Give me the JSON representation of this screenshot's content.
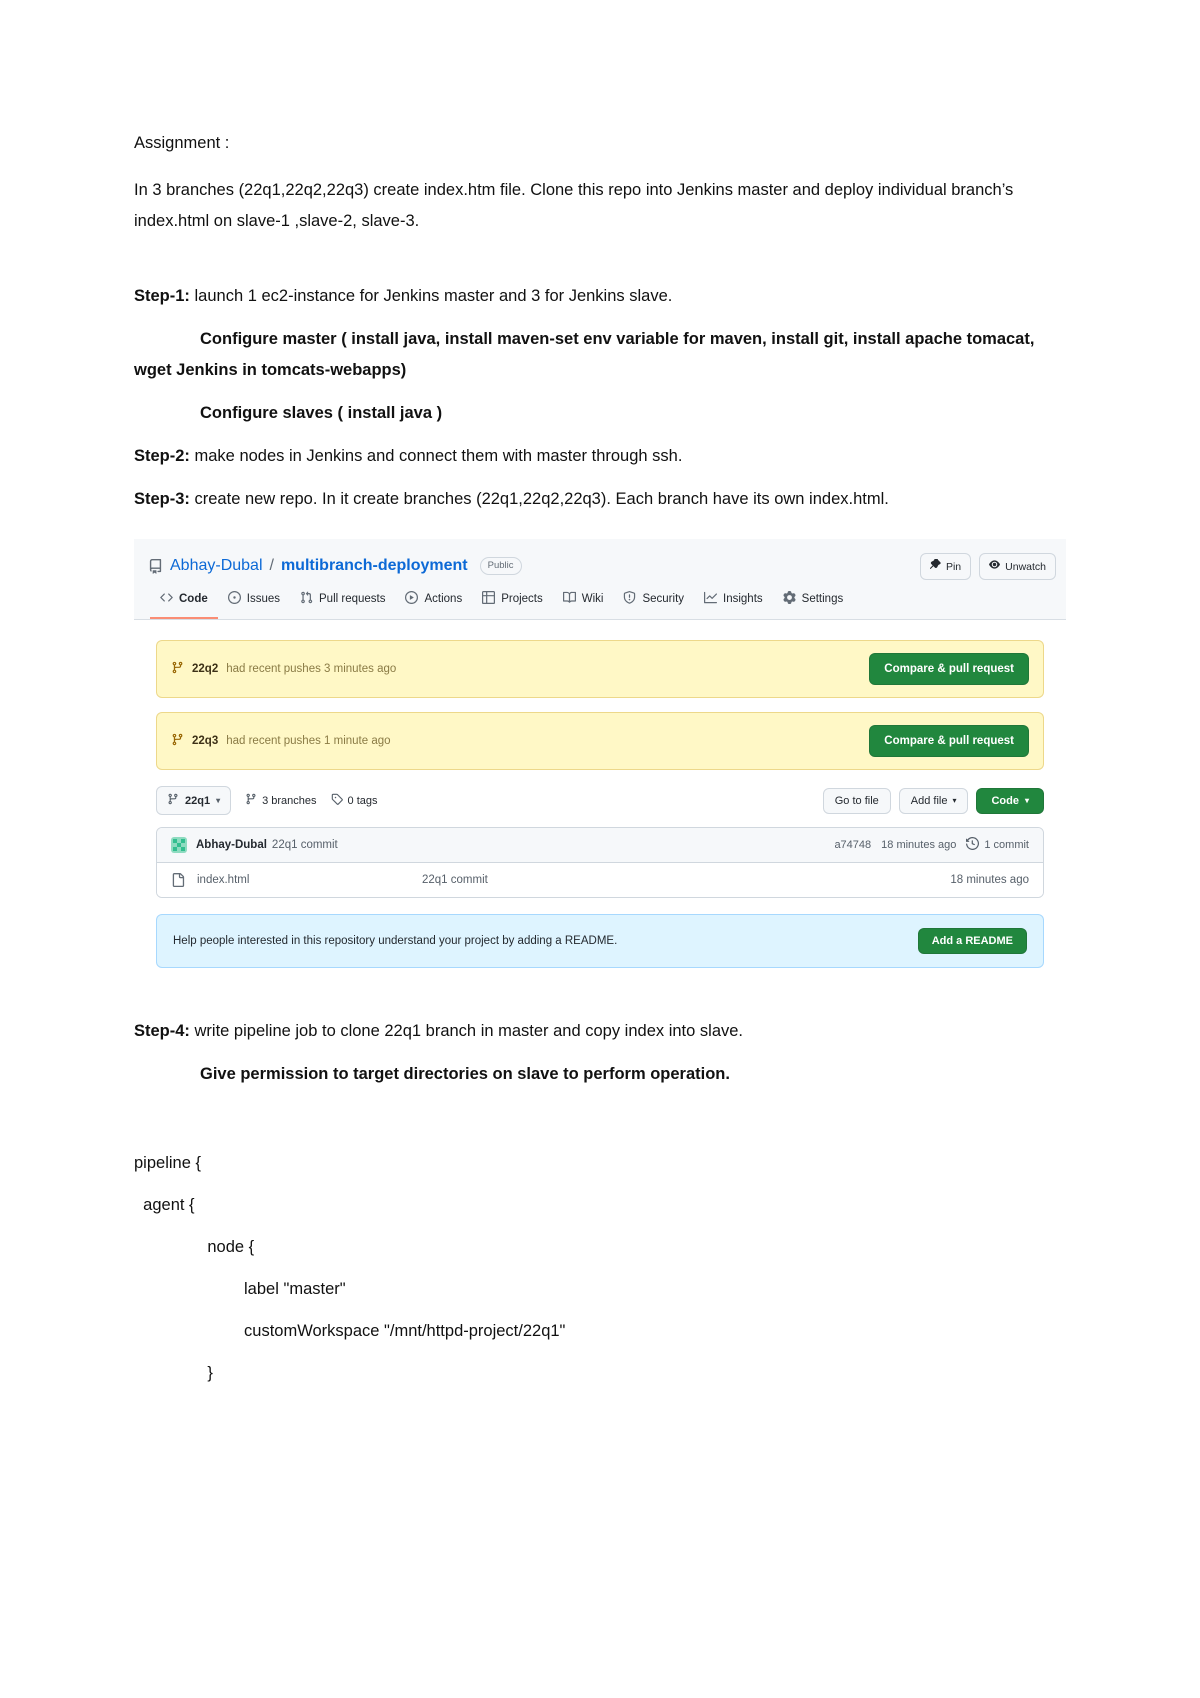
{
  "document": {
    "title": "Assignment :",
    "intro": " In 3 branches (22q1,22q2,22q3) create index.htm file. Clone this repo into Jenkins master and deploy individual branch’s index.html on slave-1 ,slave-2, slave-3.",
    "step1_label": "Step-1:",
    "step1_text": " launch 1 ec2-instance for Jenkins master and 3 for Jenkins slave.",
    "configure_master": "Configure master ( install java, install maven-set env variable for maven, install git, install apache tomacat, wget Jenkins in tomcats-webapps)",
    "configure_slaves": "Configure slaves ( install java )",
    "step2_label": "Step-2:",
    "step2_text": " make nodes in Jenkins and connect them with master through ssh.",
    "step3_label": "Step-3:",
    "step3_text": " create new repo. In it create branches (22q1,22q2,22q3).  Each branch have its own index.html.",
    "step4_label": "Step-4:",
    "step4_text": "  write pipeline job to clone 22q1 branch in master and copy index into slave.",
    "permission_note": "Give permission to target directories on slave to perform operation.",
    "code_lines": [
      "pipeline {",
      "  agent {",
      "                node {",
      "                        label \"master\"",
      "                        customWorkspace \"/mnt/httpd-project/22q1\"",
      "                }"
    ]
  },
  "github": {
    "repo": {
      "owner": "Abhay-Dubal",
      "separator": "/",
      "name": "multibranch-deployment",
      "visibility": "Public"
    },
    "header_actions": [
      {
        "label": "Pin",
        "icon": "pin-icon"
      },
      {
        "label": "Unwatch",
        "icon": "eye-icon"
      }
    ],
    "tabs": [
      {
        "label": "Code",
        "icon": "code-icon",
        "active": true
      },
      {
        "label": "Issues",
        "icon": "issue-opened-icon",
        "active": false
      },
      {
        "label": "Pull requests",
        "icon": "git-pull-request-icon",
        "active": false
      },
      {
        "label": "Actions",
        "icon": "play-icon",
        "active": false
      },
      {
        "label": "Projects",
        "icon": "table-icon",
        "active": false
      },
      {
        "label": "Wiki",
        "icon": "book-icon",
        "active": false
      },
      {
        "label": "Security",
        "icon": "shield-icon",
        "active": false
      },
      {
        "label": "Insights",
        "icon": "graph-icon",
        "active": false
      },
      {
        "label": "Settings",
        "icon": "gear-icon",
        "active": false
      }
    ],
    "notices": [
      {
        "branch": "22q2",
        "text": "had recent pushes 3 minutes ago",
        "button": "Compare & pull request"
      },
      {
        "branch": "22q3",
        "text": "had recent pushes 1 minute ago",
        "button": "Compare & pull request"
      }
    ],
    "toolbar": {
      "branch": "22q1",
      "branches_count": "3 branches",
      "tags_count": "0 tags",
      "go_to_file": "Go to file",
      "add_file": "Add file",
      "code_button": "Code"
    },
    "commit": {
      "author": "Abhay-Dubal",
      "message": "22q1 commit",
      "sha": "a74748",
      "time": "18 minutes ago",
      "count": "1 commit"
    },
    "files": [
      {
        "name": "index.html",
        "message": "22q1 commit",
        "time": "18 minutes ago",
        "icon": "file-icon"
      }
    ],
    "readme": {
      "text": "Help people interested in this repository understand your project by adding a README.",
      "button": "Add a README"
    },
    "colors": {
      "accent": "#0969da",
      "green": "#1f883d",
      "notice_bg": "#fff8c5",
      "readme_bg": "#ddf4ff",
      "active_tab": "#fd8c73"
    }
  }
}
